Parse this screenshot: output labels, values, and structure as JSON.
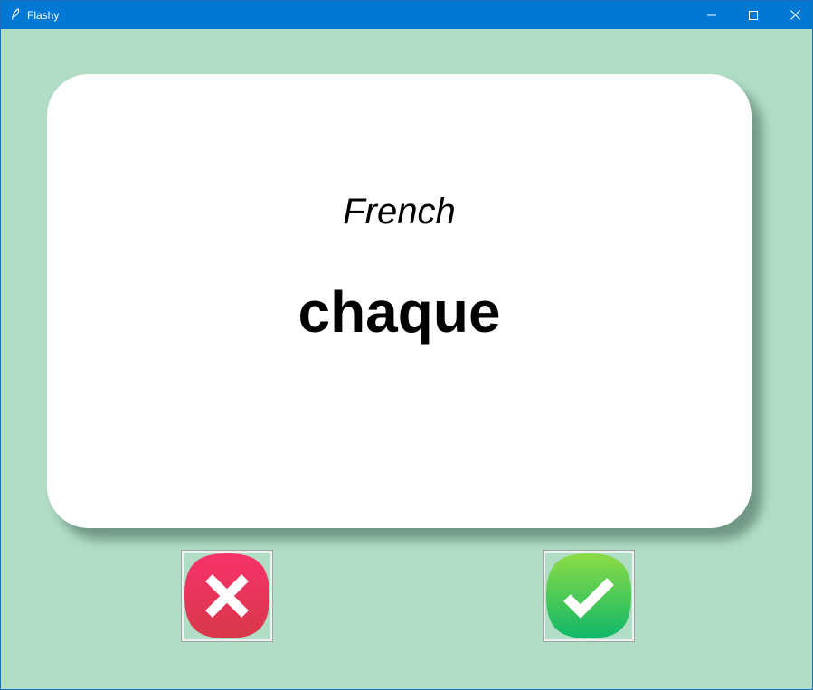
{
  "window": {
    "title": "Flashy",
    "controls": [
      "minimize",
      "maximize",
      "close"
    ]
  },
  "card": {
    "title": "French",
    "word": "chaque"
  },
  "buttons": {
    "wrong": {
      "icon": "cross-icon",
      "color": "#e8335c"
    },
    "right": {
      "icon": "checkmark-icon",
      "color": "#23c26a"
    }
  },
  "colors": {
    "background": "#b1ddc6",
    "titlebar": "#0078d4",
    "card": "#ffffff"
  }
}
